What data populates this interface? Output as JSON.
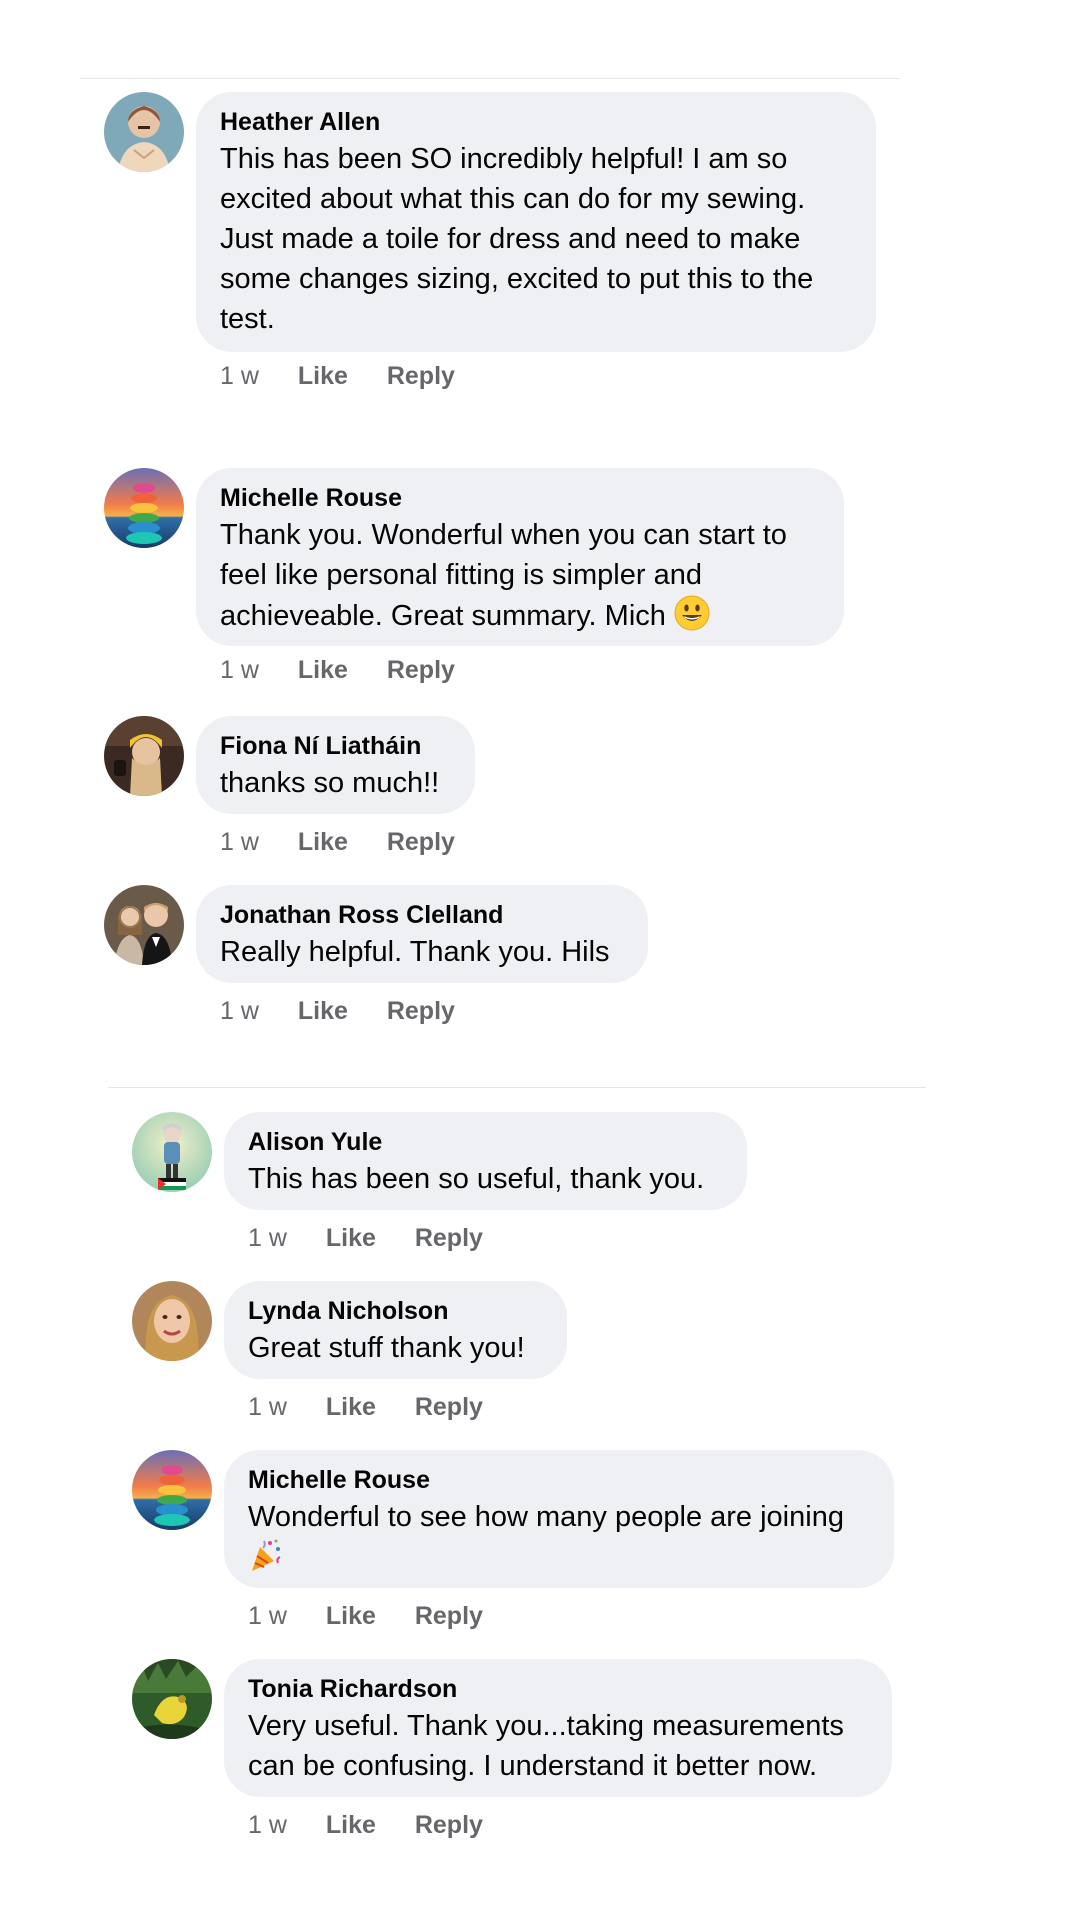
{
  "comments": [
    {
      "author": "Heather Allen",
      "text": "This has been SO incredibly helpful! I am so excited about what this can do for my sewing. Just made a toile for dress and need to make some changes sizing, excited to put this to the test.",
      "time": "1 w",
      "like": "Like",
      "reply": "Reply"
    },
    {
      "author": "Michelle Rouse",
      "text": "Thank you. Wonderful when you can start to feel like personal fitting is simpler and achieveable. Great summary. Mich",
      "emoji": "grinning-face-emoji",
      "time": "1 w",
      "like": "Like",
      "reply": "Reply"
    },
    {
      "author": "Fiona Ní Liatháin",
      "text": "thanks so much!!",
      "time": "1 w",
      "like": "Like",
      "reply": "Reply"
    },
    {
      "author": "Jonathan Ross Clelland",
      "text": "Really helpful. Thank you. Hils",
      "time": "1 w",
      "like": "Like",
      "reply": "Reply"
    },
    {
      "author": "Alison Yule",
      "text": "This has been so useful, thank you.",
      "time": "1 w",
      "like": "Like",
      "reply": "Reply"
    },
    {
      "author": "Lynda Nicholson",
      "text": "Great stuff thank you!",
      "time": "1 w",
      "like": "Like",
      "reply": "Reply"
    },
    {
      "author": "Michelle Rouse",
      "text": "Wonderful to see how many people are joining",
      "emoji": "party-popper-emoji",
      "time": "1 w",
      "like": "Like",
      "reply": "Reply"
    },
    {
      "author": "Tonia Richardson",
      "text": "Very useful. Thank you...taking measurements can be confusing. I understand it better now.",
      "time": "1 w",
      "like": "Like",
      "reply": "Reply"
    }
  ],
  "colors": {
    "bubble": "#eff0f4",
    "meta": "#65676b",
    "divider": "#e4e6eb"
  }
}
